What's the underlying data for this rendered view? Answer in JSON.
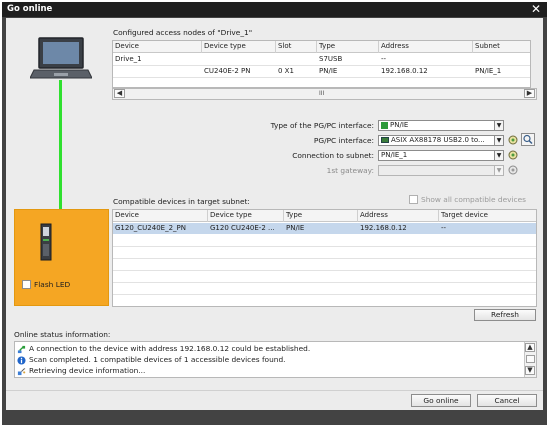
{
  "dialog": {
    "title": "Go online",
    "close_glyph": "✕"
  },
  "configured": {
    "label": "Configured access nodes of \"Drive_1\"",
    "columns": [
      "Device",
      "Device type",
      "Slot",
      "Type",
      "Address",
      "Subnet"
    ],
    "rows": [
      [
        "Drive_1",
        "",
        "",
        "S7USB",
        "--",
        ""
      ],
      [
        "",
        "CU240E-2 PN",
        "0 X1",
        "PN/IE",
        "192.168.0.12",
        "PN/IE_1"
      ]
    ],
    "scroll_mark": "III"
  },
  "interface": {
    "type_label": "Type of the PG/PC interface:",
    "type_value": "PN/IE",
    "pgpc_label": "PG/PC interface:",
    "pgpc_value": "ASIX AX88178 USB2.0 to...",
    "subnet_label": "Connection to subnet:",
    "subnet_value": "PN/IE_1",
    "gateway_label": "1st gateway:",
    "gateway_value": ""
  },
  "compatible": {
    "label": "Compatible devices in target subnet:",
    "show_all_label": "Show all compatible devices",
    "columns": [
      "Device",
      "Device type",
      "Type",
      "Address",
      "Target device"
    ],
    "rows": [
      [
        "G120_CU240E_2_PN",
        "G120 CU240E-2 ...",
        "PN/IE",
        "192.168.0.12",
        "--"
      ]
    ]
  },
  "device_panel": {
    "flash_led_label": "Flash LED"
  },
  "buttons": {
    "refresh": "Refresh",
    "go_online": "Go online",
    "cancel": "Cancel"
  },
  "status": {
    "label": "Online status information:",
    "messages": [
      {
        "icon": "network-connect-icon",
        "text": "A connection to the device with address 192.168.0.12 could be established."
      },
      {
        "icon": "info-icon",
        "text": "Scan completed. 1 compatible devices of 1 accessible devices found."
      },
      {
        "icon": "retrieving-icon",
        "text": "Retrieving device information..."
      }
    ]
  },
  "colors": {
    "orange_panel": "#f5a623",
    "link_line": "#2fe02f",
    "selected_row": "#c5d7ec",
    "title_bar": "#1f1f1f"
  }
}
